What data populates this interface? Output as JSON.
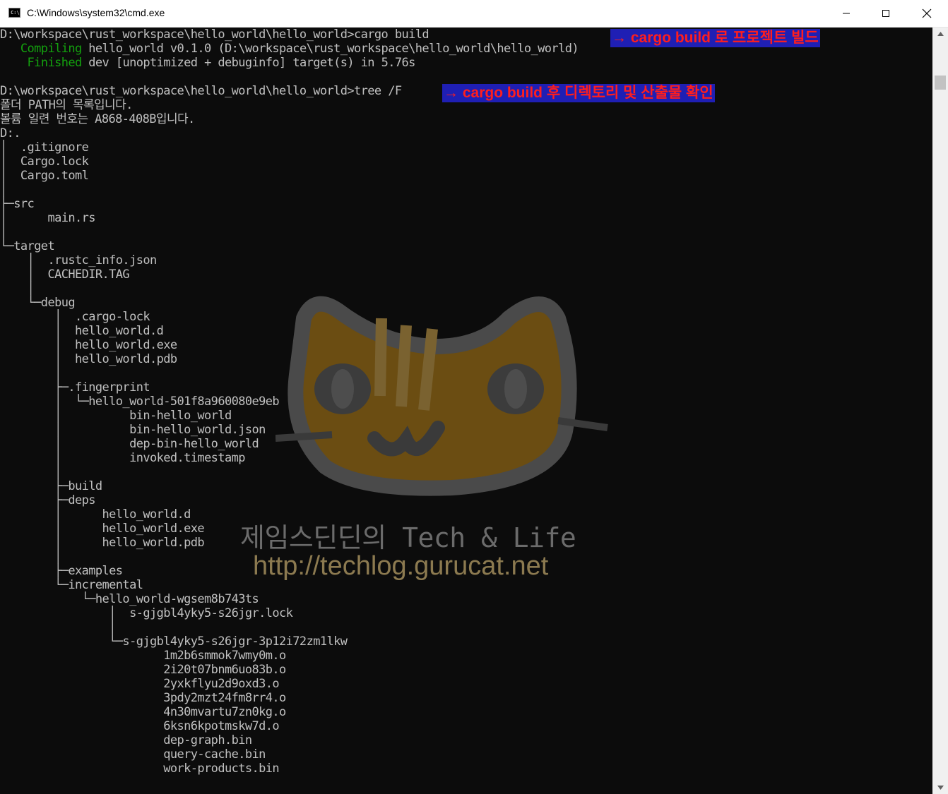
{
  "window": {
    "title": "C:\\Windows\\system32\\cmd.exe",
    "icon_label": "C:\\",
    "controls": {
      "minimize": "minimize-icon",
      "maximize": "maximize-icon",
      "close": "close-icon"
    }
  },
  "console": {
    "background": "#0c0c0c",
    "text_color": "#c0c0c0",
    "accent_green": "#13a10e",
    "lines": [
      {
        "pre": "D:\\workspace\\rust_workspace\\hello_world\\hello_world>cargo build",
        "hl": "",
        "post": ""
      },
      {
        "pre": "   ",
        "hl": "Compiling",
        "post": " hello_world v0.1.0 (D:\\workspace\\rust_workspace\\hello_world\\hello_world)"
      },
      {
        "pre": "    ",
        "hl": "Finished",
        "post": " dev [unoptimized + debuginfo] target(s) in 5.76s"
      },
      {
        "pre": "",
        "hl": "",
        "post": ""
      },
      {
        "pre": "D:\\workspace\\rust_workspace\\hello_world\\hello_world>tree /F",
        "hl": "",
        "post": ""
      },
      {
        "pre": "폴더 PATH의 목록입니다.",
        "hl": "",
        "post": ""
      },
      {
        "pre": "볼륨 일련 번호는 A868-408B입니다.",
        "hl": "",
        "post": ""
      },
      {
        "pre": "D:.",
        "hl": "",
        "post": ""
      },
      {
        "pre": "│  .gitignore",
        "hl": "",
        "post": ""
      },
      {
        "pre": "│  Cargo.lock",
        "hl": "",
        "post": ""
      },
      {
        "pre": "│  Cargo.toml",
        "hl": "",
        "post": ""
      },
      {
        "pre": "│",
        "hl": "",
        "post": ""
      },
      {
        "pre": "├─src",
        "hl": "",
        "post": ""
      },
      {
        "pre": "│      main.rs",
        "hl": "",
        "post": ""
      },
      {
        "pre": "│",
        "hl": "",
        "post": ""
      },
      {
        "pre": "└─target",
        "hl": "",
        "post": ""
      },
      {
        "pre": "    │  .rustc_info.json",
        "hl": "",
        "post": ""
      },
      {
        "pre": "    │  CACHEDIR.TAG",
        "hl": "",
        "post": ""
      },
      {
        "pre": "    │",
        "hl": "",
        "post": ""
      },
      {
        "pre": "    └─debug",
        "hl": "",
        "post": ""
      },
      {
        "pre": "        │  .cargo-lock",
        "hl": "",
        "post": ""
      },
      {
        "pre": "        │  hello_world.d",
        "hl": "",
        "post": ""
      },
      {
        "pre": "        │  hello_world.exe",
        "hl": "",
        "post": ""
      },
      {
        "pre": "        │  hello_world.pdb",
        "hl": "",
        "post": ""
      },
      {
        "pre": "        │",
        "hl": "",
        "post": ""
      },
      {
        "pre": "        ├─.fingerprint",
        "hl": "",
        "post": ""
      },
      {
        "pre": "        │  └─hello_world-501f8a960080e9eb",
        "hl": "",
        "post": ""
      },
      {
        "pre": "        │          bin-hello_world",
        "hl": "",
        "post": ""
      },
      {
        "pre": "        │          bin-hello_world.json",
        "hl": "",
        "post": ""
      },
      {
        "pre": "        │          dep-bin-hello_world",
        "hl": "",
        "post": ""
      },
      {
        "pre": "        │          invoked.timestamp",
        "hl": "",
        "post": ""
      },
      {
        "pre": "        │",
        "hl": "",
        "post": ""
      },
      {
        "pre": "        ├─build",
        "hl": "",
        "post": ""
      },
      {
        "pre": "        ├─deps",
        "hl": "",
        "post": ""
      },
      {
        "pre": "        │      hello_world.d",
        "hl": "",
        "post": ""
      },
      {
        "pre": "        │      hello_world.exe",
        "hl": "",
        "post": ""
      },
      {
        "pre": "        │      hello_world.pdb",
        "hl": "",
        "post": ""
      },
      {
        "pre": "        │",
        "hl": "",
        "post": ""
      },
      {
        "pre": "        ├─examples",
        "hl": "",
        "post": ""
      },
      {
        "pre": "        └─incremental",
        "hl": "",
        "post": ""
      },
      {
        "pre": "            └─hello_world-wgsem8b743ts",
        "hl": "",
        "post": ""
      },
      {
        "pre": "                │  s-gjgbl4yky5-s26jgr.lock",
        "hl": "",
        "post": ""
      },
      {
        "pre": "                │",
        "hl": "",
        "post": ""
      },
      {
        "pre": "                └─s-gjgbl4yky5-s26jgr-3p12i72zm1lkw",
        "hl": "",
        "post": ""
      },
      {
        "pre": "                        1m2b6smmok7wmy0m.o",
        "hl": "",
        "post": ""
      },
      {
        "pre": "                        2i20t07bnm6uo83b.o",
        "hl": "",
        "post": ""
      },
      {
        "pre": "                        2yxkflyu2d9oxd3.o",
        "hl": "",
        "post": ""
      },
      {
        "pre": "                        3pdy2mzt24fm8rr4.o",
        "hl": "",
        "post": ""
      },
      {
        "pre": "                        4n30mvartu7zn0kg.o",
        "hl": "",
        "post": ""
      },
      {
        "pre": "                        6ksn6kpotmskw7d.o",
        "hl": "",
        "post": ""
      },
      {
        "pre": "                        dep-graph.bin",
        "hl": "",
        "post": ""
      },
      {
        "pre": "                        query-cache.bin",
        "hl": "",
        "post": ""
      },
      {
        "pre": "                        work-products.bin",
        "hl": "",
        "post": ""
      }
    ]
  },
  "annotations": {
    "build": "→ cargo build 로 프로젝트 빌드",
    "tree": "→ cargo build 후 디렉토리 및 산출물 확인",
    "badge_bg": "#1f1fb4",
    "badge_fg": "#ff1e1e"
  },
  "watermark": {
    "line1": "제임스딘딘의 Tech & Life",
    "line2": "http://techlog.gurucat.net",
    "icon": "cat-face-icon"
  }
}
